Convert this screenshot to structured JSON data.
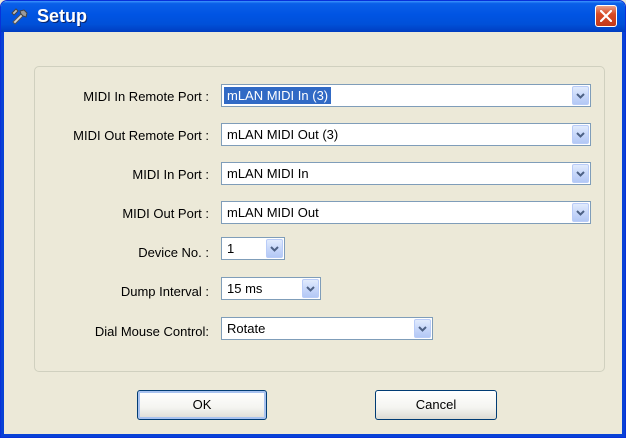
{
  "window": {
    "title": "Setup"
  },
  "fields": [
    {
      "label": "MIDI In Remote Port :",
      "value": "mLAN MIDI In (3)"
    },
    {
      "label": "MIDI Out Remote Port :",
      "value": "mLAN MIDI Out (3)"
    },
    {
      "label": "MIDI In Port :",
      "value": "mLAN MIDI In"
    },
    {
      "label": "MIDI Out Port :",
      "value": "mLAN MIDI Out"
    },
    {
      "label": "Device No. :",
      "value": "1"
    },
    {
      "label": "Dump Interval :",
      "value": "15 ms"
    },
    {
      "label": "Dial Mouse Control:",
      "value": "Rotate"
    }
  ],
  "buttons": {
    "ok": "OK",
    "cancel": "Cancel"
  },
  "icons": {
    "title": "setup-tool-icon",
    "close": "close-icon",
    "dropdown": "chevron-down-icon"
  }
}
